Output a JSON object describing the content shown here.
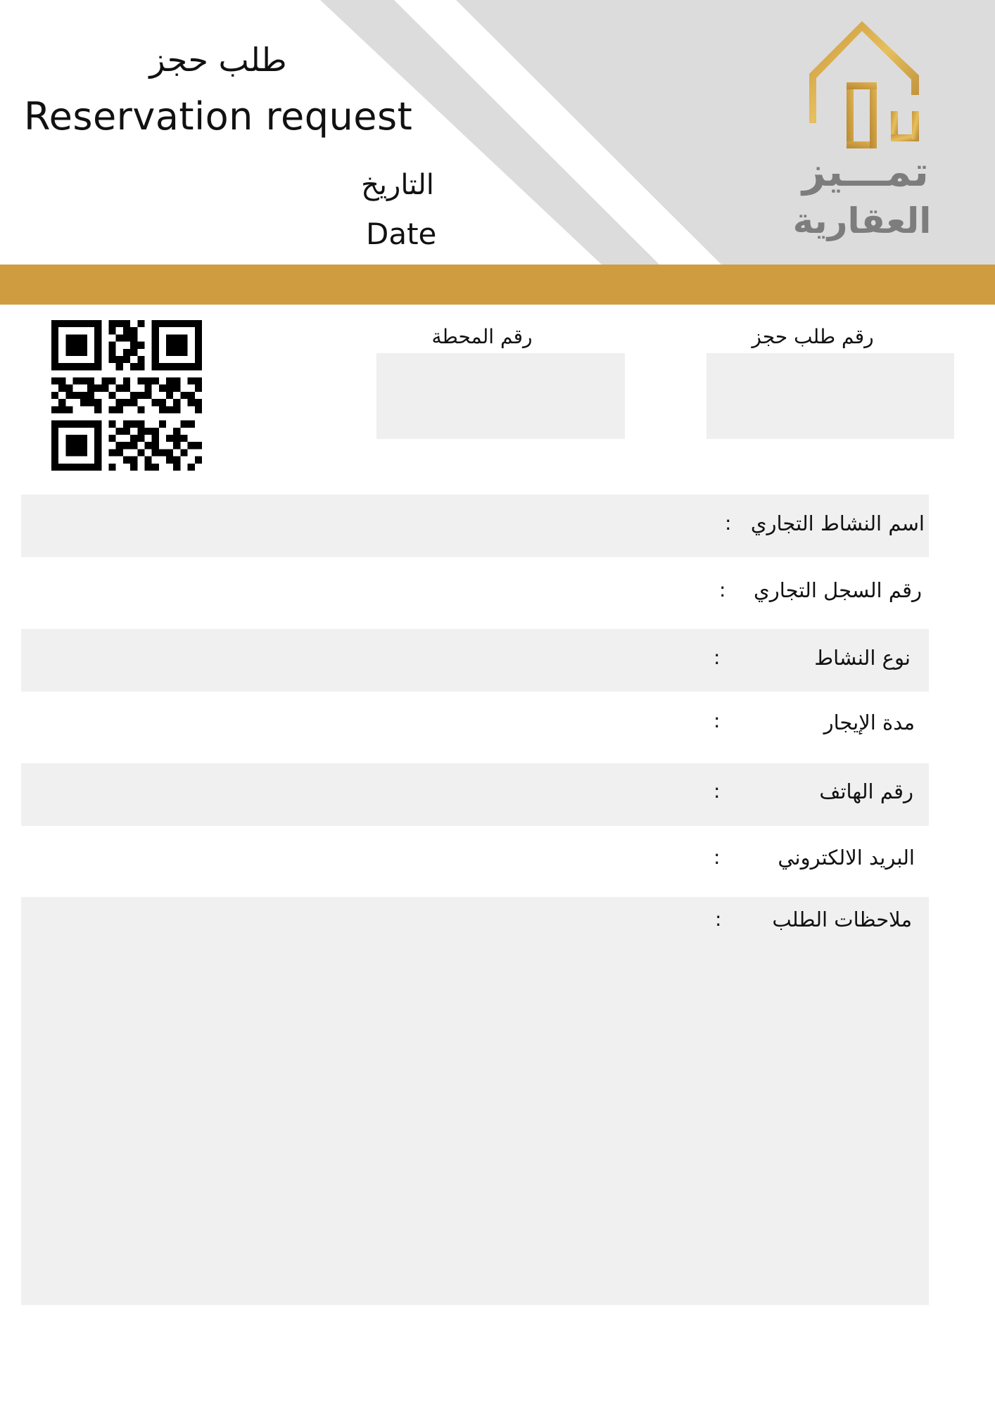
{
  "header": {
    "title_ar": "طلب حجز",
    "title_en": "Reservation request",
    "date_ar": "التاريخ",
    "date_en": "Date"
  },
  "logo": {
    "line1": "تمـــيز",
    "line2": "العقارية"
  },
  "colors": {
    "gold": "#cf9d3f",
    "panel_gray": "#dcdcdc",
    "field_gray": "#f0f0f0",
    "logo_text": "#7d7d7d"
  },
  "boxes": {
    "reservation_number_label": "رقم طلب حجز",
    "station_number_label": "رقم المحطة"
  },
  "fields": [
    {
      "label": "اسم النشاط التجاري",
      "colon": ":"
    },
    {
      "label": "رقم السجل التجاري",
      "colon": ":"
    },
    {
      "label": "نوع النشاط",
      "colon": ":"
    },
    {
      "label": "مدة الإيجار",
      "colon": ":"
    },
    {
      "label": "رقم الهاتف",
      "colon": ":"
    },
    {
      "label": "البريد الالكتروني",
      "colon": ":"
    },
    {
      "label": "ملاحظات الطلب",
      "colon": ":"
    }
  ],
  "qr": {
    "icon": "qr-code-icon"
  }
}
